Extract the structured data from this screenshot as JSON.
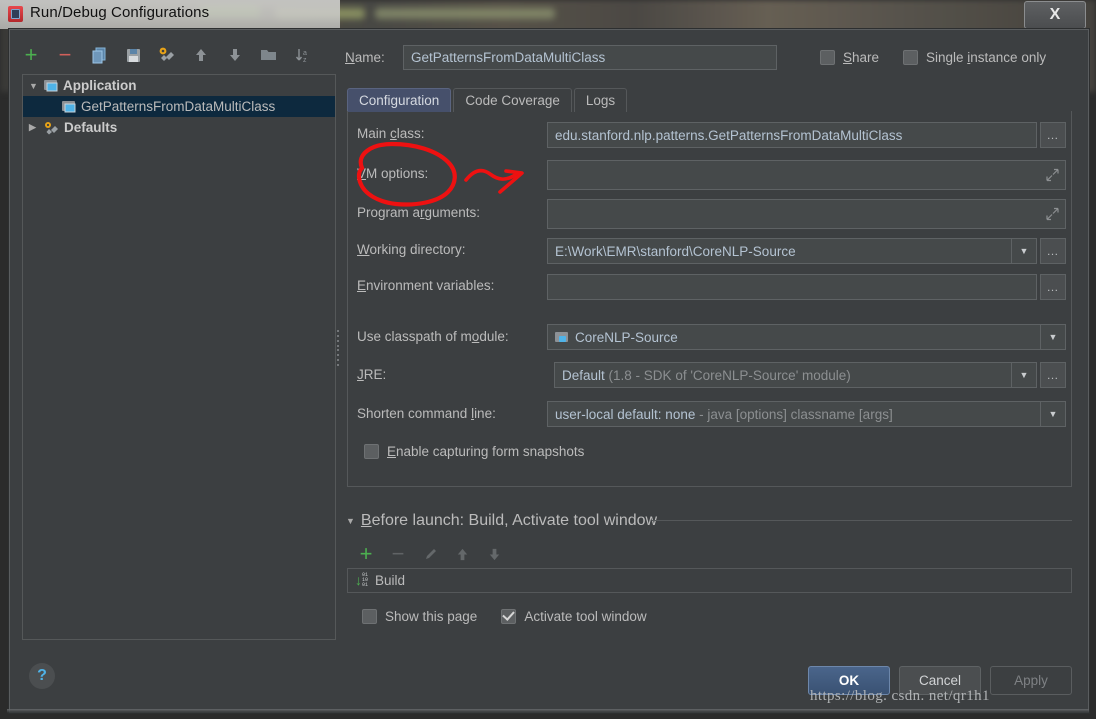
{
  "window": {
    "title": "Run/Debug Configurations",
    "close_label": "X",
    "app_icon": "idea-icon"
  },
  "sidebar": {
    "toolbar": [
      {
        "name": "add-configuration-button",
        "glyph": "+"
      },
      {
        "name": "remove-configuration-button",
        "glyph": "–"
      },
      {
        "name": "copy-configuration-button",
        "glyph": "⧉"
      },
      {
        "name": "save-configuration-button",
        "glyph": "Ὃe"
      },
      {
        "name": "edit-defaults-button",
        "glyph": "⚒"
      },
      {
        "name": "move-up-button",
        "glyph": "↑"
      },
      {
        "name": "move-down-button",
        "glyph": "↓"
      },
      {
        "name": "new-folder-button",
        "glyph": "▬"
      },
      {
        "name": "sort-alphabetically-button",
        "glyph": "↓az"
      }
    ],
    "tree": [
      {
        "label": "Application",
        "expanded": true,
        "bold": true,
        "selected": false,
        "indent": 0,
        "icon": "application-icon"
      },
      {
        "label": "GetPatternsFromDataMultiClass",
        "expanded": null,
        "bold": false,
        "selected": true,
        "indent": 1,
        "icon": "application-icon"
      },
      {
        "label": "Defaults",
        "expanded": false,
        "bold": true,
        "selected": false,
        "indent": 0,
        "icon": "wrench-icon"
      }
    ]
  },
  "header": {
    "name_label": "Name:",
    "name_value": "GetPatternsFromDataMultiClass",
    "share_label": "Share",
    "share_checked": false,
    "single_instance_label": "Single instance only",
    "single_instance_checked": false
  },
  "tabs": [
    {
      "label": "Configuration",
      "active": true
    },
    {
      "label": "Code Coverage",
      "active": false
    },
    {
      "label": "Logs",
      "active": false
    }
  ],
  "configuration": {
    "main_class": {
      "label": "Main class:",
      "value": "edu.stanford.nlp.patterns.GetPatternsFromDataMultiClass",
      "browse_label": "…"
    },
    "vm_options": {
      "label": "VM options:",
      "value": "",
      "expand_icon": "expand-icon"
    },
    "program_arguments": {
      "label": "Program arguments:",
      "value": "",
      "expand_icon": "expand-icon"
    },
    "working_directory": {
      "label": "Working directory:",
      "value": "E:\\Work\\EMR\\stanford\\CoreNLP-Source",
      "browse_label": "…"
    },
    "environment_variables": {
      "label": "Environment variables:",
      "value": "",
      "browse_label": "…"
    },
    "use_classpath": {
      "label": "Use classpath of module:",
      "value": "CoreNLP-Source",
      "icon": "module-icon"
    },
    "jre": {
      "label": "JRE:",
      "value": "Default",
      "value_hint": "(1.8 - SDK of 'CoreNLP-Source' module)",
      "browse_label": "…"
    },
    "shorten_command_line": {
      "label": "Shorten command line:",
      "value": "user-local default: none",
      "value_hint": "- java [options] classname [args]"
    },
    "enable_snapshots": {
      "label": "Enable capturing form snapshots",
      "checked": false
    }
  },
  "before_launch": {
    "header": "Before launch: Build, Activate tool window",
    "toolbar": [
      {
        "name": "add-task-button",
        "glyph": "+",
        "enabled": true
      },
      {
        "name": "remove-task-button",
        "glyph": "–",
        "enabled": false
      },
      {
        "name": "edit-task-button",
        "glyph": "✎",
        "enabled": false
      },
      {
        "name": "move-task-up-button",
        "glyph": "↑",
        "enabled": false
      },
      {
        "name": "move-task-down-button",
        "glyph": "↓",
        "enabled": false
      }
    ],
    "tasks": [
      {
        "label": "Build",
        "icon": "build-icon"
      }
    ],
    "show_this_page": {
      "label": "Show this page",
      "checked": false
    },
    "activate_tool_window": {
      "label": "Activate tool window",
      "checked": true
    }
  },
  "footer": {
    "help_label": "?",
    "ok_label": "OK",
    "cancel_label": "Cancel",
    "apply_label": "Apply"
  },
  "watermark": {
    "text": "https://blog. csdn. net/qr1h1"
  },
  "annotation": {
    "color": "#ee1111",
    "shape": "circle-around-vm-options-with-arrow"
  }
}
